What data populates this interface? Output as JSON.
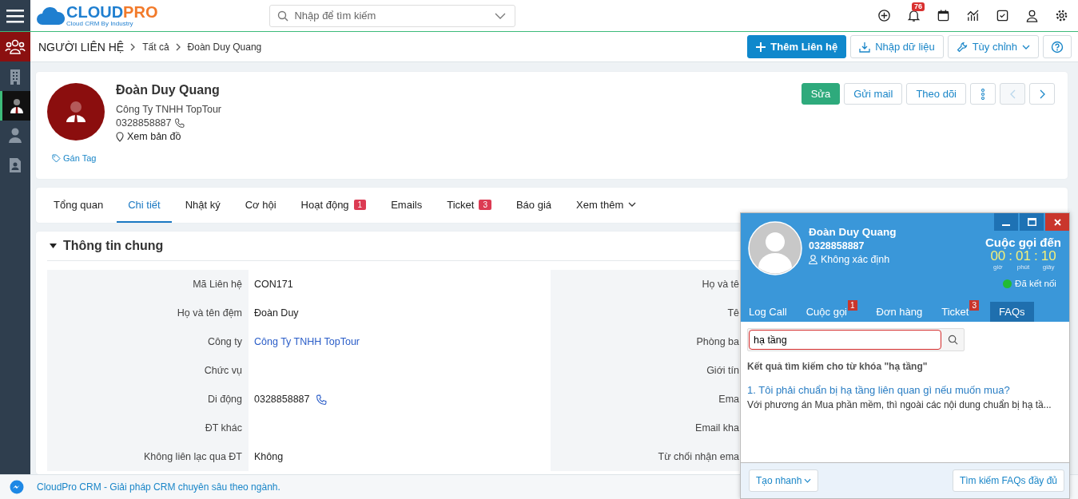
{
  "sidebar": {
    "items": [
      {
        "kind": "module",
        "selected": false
      },
      {
        "kind": "link",
        "selected": false
      },
      {
        "kind": "link",
        "selected": true
      },
      {
        "kind": "link",
        "selected": false
      },
      {
        "kind": "link",
        "selected": false
      }
    ]
  },
  "top_bar": {
    "logo": {
      "word_1": "CLOUD",
      "word_2": "PRO",
      "tagline": "Cloud CRM By Industry"
    },
    "search": {
      "placeholder": "Nhập để tìm kiếm"
    },
    "notification_count": "76"
  },
  "breadcrumb": [
    "NGƯỜI LIÊN HỆ",
    "Tất cả",
    "Đoàn Duy Quang"
  ],
  "header_buttons": [
    {
      "label": "Thêm Liên hệ",
      "kind": "primary"
    },
    {
      "label": "Nhập dữ liệu",
      "kind": "import"
    },
    {
      "label": "Tùy chỉnh",
      "kind": "dropdown"
    }
  ],
  "profile": {
    "name": "Đoàn Duy Quang",
    "company": "Công Ty TNHH TopTour",
    "phone": "0328858887",
    "map_link": "Xem bản đồ",
    "tag_link": "Gán Tag",
    "actions": [
      {
        "label": "Sửa",
        "kind": "primary"
      },
      {
        "label": "Gửi mail",
        "kind": "plain"
      },
      {
        "label": "Theo dõi",
        "kind": "plain"
      }
    ],
    "nav": {
      "prev_disabled": true,
      "next_disabled": false
    }
  },
  "tabs": [
    {
      "label": "Tổng quan",
      "selected": false
    },
    {
      "label": "Chi tiết",
      "selected": true
    },
    {
      "label": "Nhật ký",
      "selected": false
    },
    {
      "label": "Cơ hội",
      "selected": false
    },
    {
      "label": "Hoạt động",
      "badge": "1",
      "selected": false
    },
    {
      "label": "Emails",
      "selected": false
    },
    {
      "label": "Ticket",
      "badge": "3",
      "selected": false
    },
    {
      "label": "Báo giá",
      "selected": false
    },
    {
      "label": "Xem thêm",
      "kind": "dropdown",
      "selected": false
    }
  ],
  "section": {
    "title": "Thông tin chung",
    "expanded": true,
    "left_fields": [
      {
        "label": "Mã Liên hệ",
        "value": "CON171",
        "kind": "text"
      },
      {
        "label": "Họ và tên đệm",
        "value": "Đoàn Duy",
        "kind": "text"
      },
      {
        "label": "Công ty",
        "value": "Công Ty TNHH TopTour",
        "kind": "link"
      },
      {
        "label": "Chức vụ"
      },
      {
        "label": "Di động",
        "value": "0328858887",
        "kind": "phone"
      },
      {
        "label": "ĐT khác"
      },
      {
        "label": "Không liên lạc qua ĐT",
        "value": "Không",
        "kind": "text"
      }
    ],
    "right_labels": [
      "Họ và tê",
      "Tê",
      "Phòng ba",
      "Giới tín",
      "Ema",
      "Email kha",
      "Từ chối nhận ema"
    ]
  },
  "call_popup": {
    "caller": {
      "name": "Đoàn Duy Quang",
      "phone": "0328858887",
      "owner": "Không xác định"
    },
    "direction": "Cuộc gọi đến",
    "timer_separator": ":",
    "timer": [
      {
        "value": "00",
        "unit": "giờ"
      },
      {
        "value": "01",
        "unit": "phút"
      },
      {
        "value": "10",
        "unit": "giây"
      }
    ],
    "status": {
      "label": "Đã kết nối",
      "color": "#22bb33"
    },
    "tabs": [
      {
        "label": "Log Call",
        "selected": false
      },
      {
        "label": "Cuộc gọi",
        "badge": "1",
        "selected": false
      },
      {
        "label": "Đơn hàng",
        "selected": false
      },
      {
        "label": "Ticket",
        "badge": "3",
        "selected": false
      },
      {
        "label": "FAQs",
        "selected": true
      }
    ],
    "faq_search": {
      "value": "hạ tầng"
    },
    "results_heading": "Kết quả tìm kiếm cho từ khóa \"hạ tầng\"",
    "results": [
      {
        "title": "1. Tôi phải chuẩn bị hạ tầng liên quan gì nếu muốn mua?",
        "snippet": "Với phương án Mua phần mềm, thì ngoài các nội dung chuẩn bị hạ tầ..."
      }
    ],
    "footer_buttons": [
      {
        "label": "Tạo nhanh",
        "kind": "dropdown"
      },
      {
        "label": "Tìm kiếm FAQs đầy đủ",
        "kind": "plain"
      }
    ]
  },
  "footer": {
    "text": "CloudPro CRM - Giải pháp CRM chuyên sâu theo ngành."
  }
}
